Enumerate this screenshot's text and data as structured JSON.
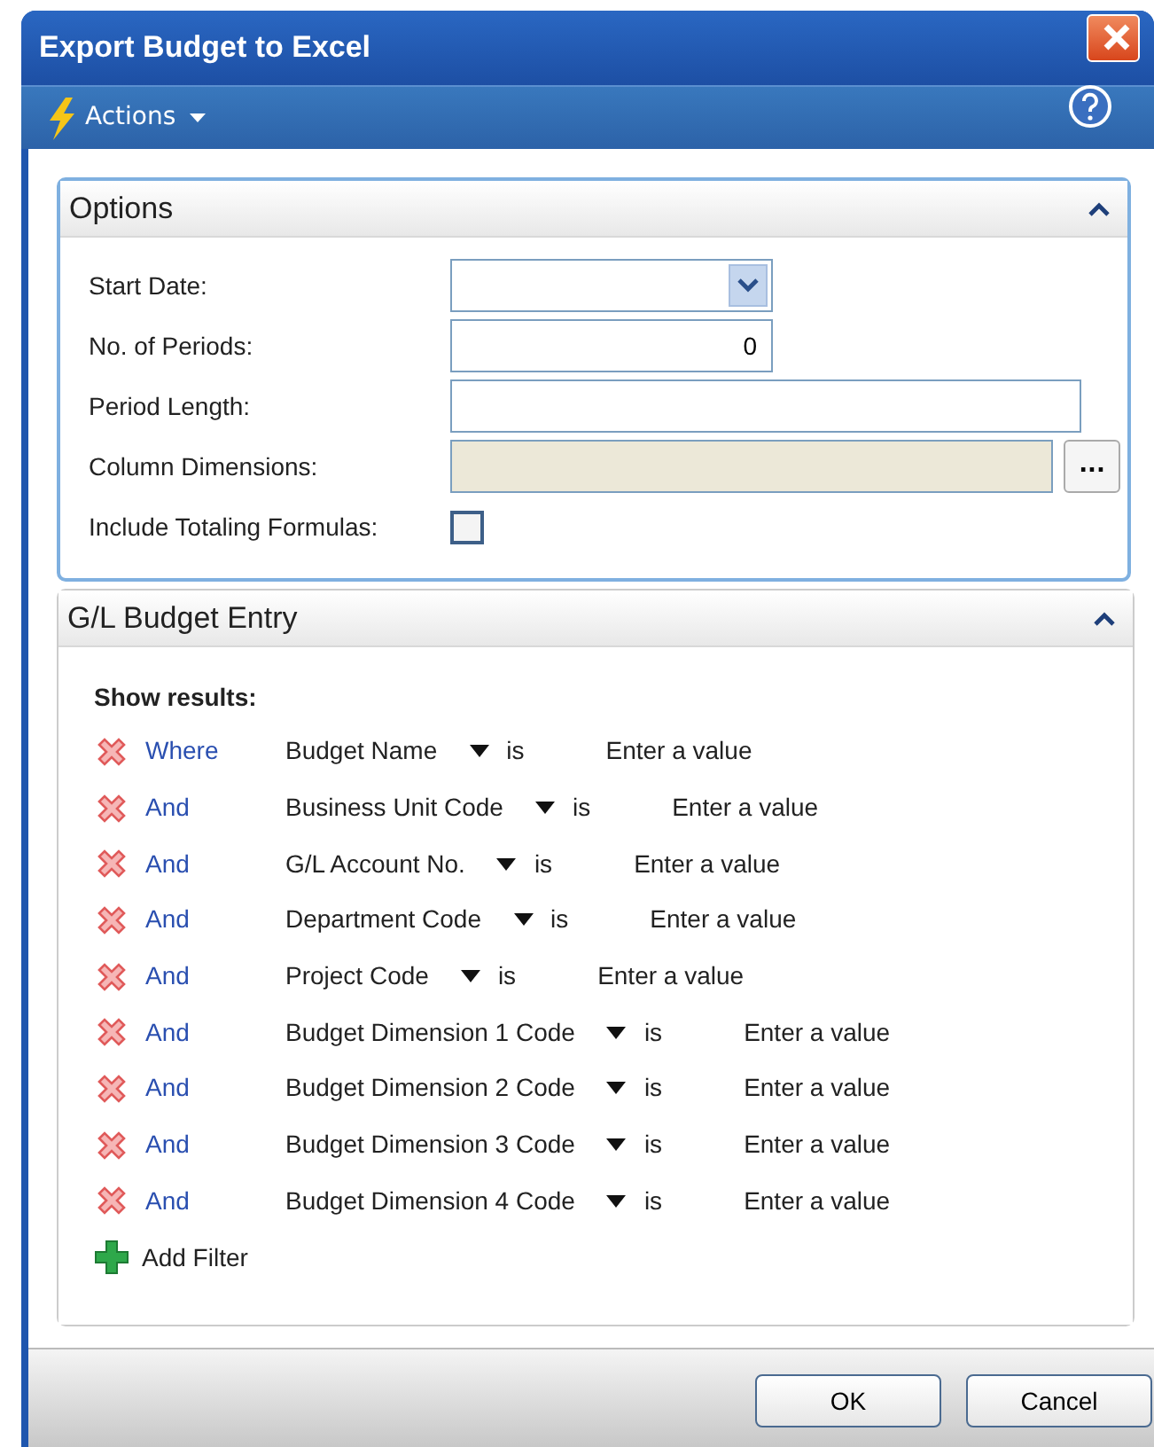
{
  "window": {
    "title": "Export Budget to Excel"
  },
  "toolbar": {
    "actions_label": "Actions"
  },
  "options": {
    "title": "Options",
    "expanded": true,
    "fields": [
      {
        "label": "Start Date:",
        "kind": "dropdown"
      },
      {
        "label": "No. of Periods:",
        "kind": "number",
        "value": "0"
      },
      {
        "label": "Period Length:",
        "kind": "text"
      },
      {
        "label": "Column Dimensions:",
        "kind": "lookup",
        "disabled": true,
        "button": "..."
      },
      {
        "label": "Include Totaling Formulas:",
        "kind": "checkbox",
        "checked": false
      }
    ]
  },
  "filter_panel": {
    "title": "G/L Budget Entry",
    "expanded": true,
    "heading": "Show results:",
    "filters": [
      {
        "connector": "Where",
        "field": "Budget Name",
        "operator": "is",
        "placeholder": "Enter a value"
      },
      {
        "connector": "And",
        "field": "Business Unit Code",
        "operator": "is",
        "placeholder": "Enter a value"
      },
      {
        "connector": "And",
        "field": "G/L Account No.",
        "operator": "is",
        "placeholder": "Enter a value"
      },
      {
        "connector": "And",
        "field": "Department Code",
        "operator": "is",
        "placeholder": "Enter a value"
      },
      {
        "connector": "And",
        "field": "Project Code",
        "operator": "is",
        "placeholder": "Enter a value"
      },
      {
        "connector": "And",
        "field": "Budget Dimension 1 Code",
        "operator": "is",
        "placeholder": "Enter a value"
      },
      {
        "connector": "And",
        "field": "Budget Dimension 2 Code",
        "operator": "is",
        "placeholder": "Enter a value"
      },
      {
        "connector": "And",
        "field": "Budget Dimension 3 Code",
        "operator": "is",
        "placeholder": "Enter a value"
      },
      {
        "connector": "And",
        "field": "Budget Dimension 4 Code",
        "operator": "is",
        "placeholder": "Enter a value"
      }
    ],
    "add_filter": "Add Filter"
  },
  "buttons": [
    "OK",
    "Cancel"
  ]
}
